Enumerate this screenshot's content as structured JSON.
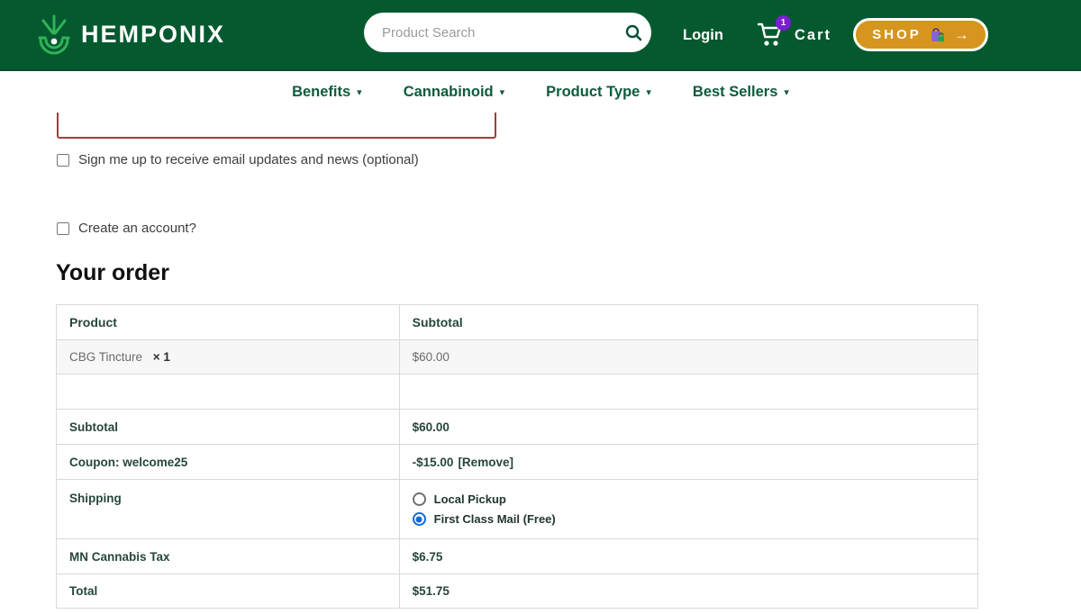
{
  "header": {
    "brand": "HEMPONIX",
    "search": {
      "placeholder": "Product Search",
      "icon": "search"
    },
    "login_label": "Login",
    "cart": {
      "label": "Cart",
      "badge_count": "1",
      "icon": "shopping-cart"
    },
    "shop_button": {
      "label": "SHOP",
      "bag_icon": "shopping-bags",
      "arrow": "→"
    }
  },
  "nav": {
    "items": [
      {
        "label": "Benefits"
      },
      {
        "label": "Cannabinoid"
      },
      {
        "label": "Product Type"
      },
      {
        "label": "Best Sellers"
      }
    ],
    "chevron": "▾"
  },
  "checkout": {
    "signup_label": "Sign me up to receive email updates and news (optional)",
    "create_account_label": "Create an account?",
    "order_heading": "Your order",
    "table": {
      "columns": {
        "product": "Product",
        "subtotal": "Subtotal"
      },
      "product_row": {
        "name": "CBG Tincture",
        "qty": "× 1",
        "subtotal": "$60.00"
      },
      "subtotal_row": {
        "label": "Subtotal",
        "value": "$60.00"
      },
      "coupon_row": {
        "label": "Coupon: welcome25",
        "value": "-$15.00",
        "remove_label": "[Remove]"
      },
      "shipping_row": {
        "label": "Shipping",
        "options": [
          {
            "label": "Local Pickup",
            "selected": false
          },
          {
            "label": "First Class Mail (Free)",
            "selected": true
          }
        ]
      },
      "tax_row": {
        "label": "MN Cannabis Tax",
        "value": "$6.75"
      },
      "total_row": {
        "label": "Total",
        "value": "$51.75"
      }
    }
  },
  "colors": {
    "header_green": "#05592f",
    "logo_green": "#2fb457",
    "nav_green": "#0e5b3c",
    "shop_amber": "#d6951f",
    "badge_purple": "#7d1dd1",
    "error_red": "#a43c3c",
    "radio_blue": "#1669d9"
  }
}
